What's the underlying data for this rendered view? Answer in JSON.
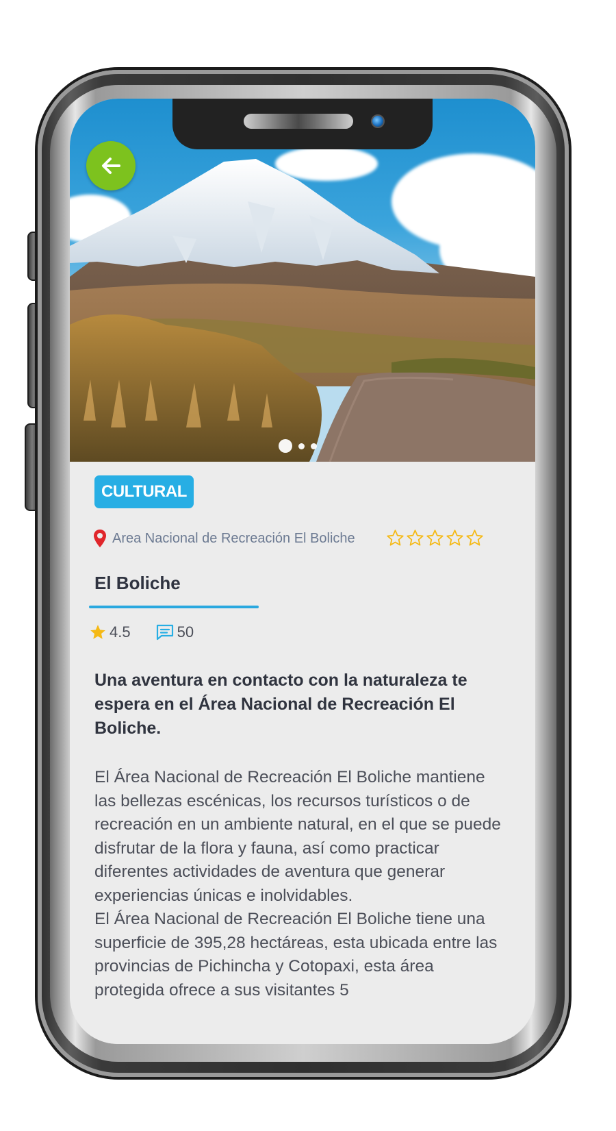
{
  "place": {
    "category": "CULTURAL",
    "location": "Area Nacional de Recreación El Boliche",
    "user_rating_stars": 0,
    "title": "El Boliche",
    "rating": "4.5",
    "comments_count": "50",
    "lead": "Una aventura en contacto con la naturaleza te espera en el Área Nacional de Recreación El Boliche.",
    "description": [
      "El Área Nacional de Recreación El Boliche mantiene las bellezas escénicas, los recursos turísticos o de recreación en un ambiente natural, en el que se puede disfrutar de la flora y fauna, así como practicar diferentes actividades de aventura que generar experiencias únicas e inolvidables.",
      "El Área Nacional de Recreación El Boliche tiene una superficie de 395,28 hectáreas, esta ubicada entre las provincias de Pichincha y Cotopaxi, esta área protegida ofrece a sus visitantes 5"
    ]
  },
  "gallery": {
    "total_images": 3,
    "active_index": 0
  },
  "colors": {
    "accent": "#27aee4",
    "back_button": "#7dc21e",
    "star": "#f5b915",
    "location_pin": "#e0262b"
  },
  "icons": {
    "back": "arrow-left-icon",
    "location": "map-pin-icon",
    "rating": "star-icon",
    "comments": "chat-icon"
  }
}
